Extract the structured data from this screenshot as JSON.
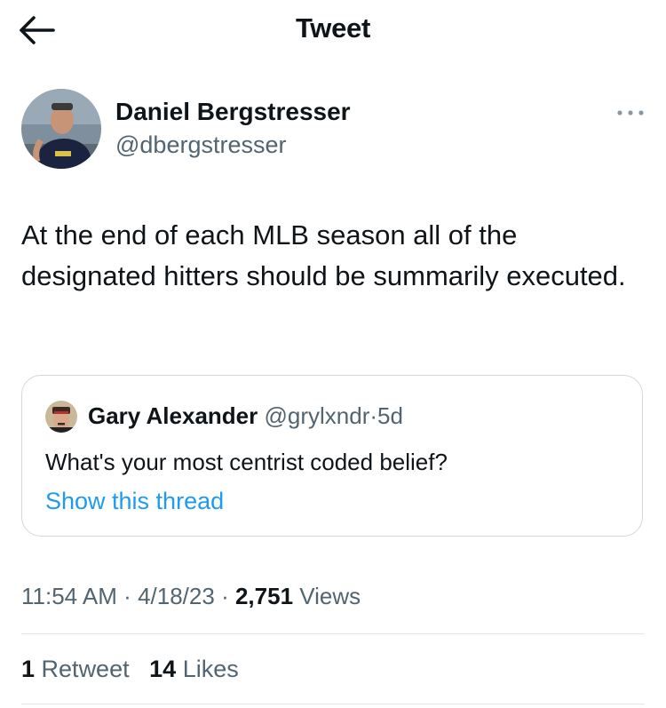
{
  "header": {
    "title": "Tweet",
    "back_icon": "arrow-left-icon"
  },
  "tweet": {
    "author_name": "Daniel Bergstresser",
    "author_handle": "@dbergstresser",
    "more_icon": "more-horizontal-icon",
    "text": "At the end of each MLB season all of the designated hitters should be summarily executed.",
    "quote": {
      "name": "Gary Alexander",
      "handle": "@grylxndr",
      "separator": "·",
      "age": "5d",
      "text": "What's your most centrist coded belief?",
      "link": "Show this thread"
    },
    "time": "11:54 AM",
    "date": "4/18/23",
    "separator": "·",
    "views_count": "2,751",
    "views_label": "Views",
    "retweets_count": "1",
    "retweets_label": "Retweet",
    "likes_count": "14",
    "likes_label": "Likes"
  },
  "colors": {
    "text": "#0f1419",
    "secondary": "#536471",
    "link": "#1d9bf0",
    "border": "#cfd9de"
  }
}
